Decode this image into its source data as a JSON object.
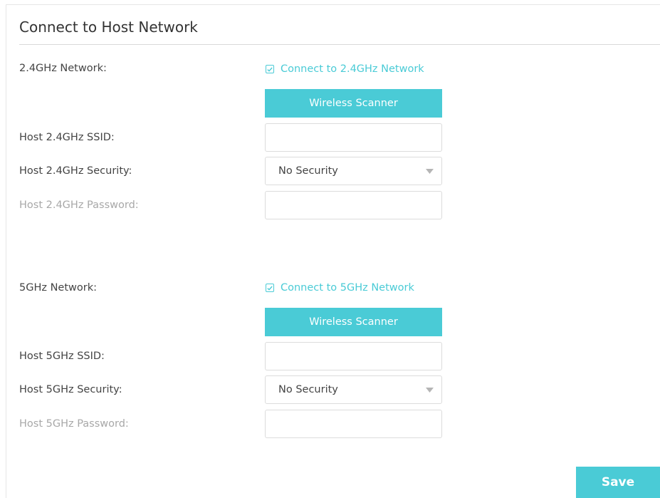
{
  "colors": {
    "accent": "#4acbd6",
    "label": "#444444",
    "muted_label": "#a8a8a8",
    "border": "#dcdcdc"
  },
  "section": {
    "title": "Connect to Host Network"
  },
  "network_24": {
    "label": "2.4GHz Network:",
    "checkbox_label": "Connect to 2.4GHz Network",
    "checked": true,
    "scanner_button": "Wireless Scanner",
    "ssid_label": "Host 2.4GHz SSID:",
    "ssid_value": "",
    "security_label": "Host 2.4GHz Security:",
    "security_value": "No Security",
    "password_label": "Host 2.4GHz Password:",
    "password_value": ""
  },
  "network_5": {
    "label": "5GHz Network:",
    "checkbox_label": "Connect to 5GHz Network",
    "checked": true,
    "scanner_button": "Wireless Scanner",
    "ssid_label": "Host 5GHz SSID:",
    "ssid_value": "",
    "security_label": "Host 5GHz Security:",
    "security_value": "No Security",
    "password_label": "Host 5GHz Password:",
    "password_value": ""
  },
  "actions": {
    "save_label": "Save"
  },
  "icons": {
    "checkmark": "checkmark-icon",
    "dropdown": "triangle-down-icon"
  }
}
